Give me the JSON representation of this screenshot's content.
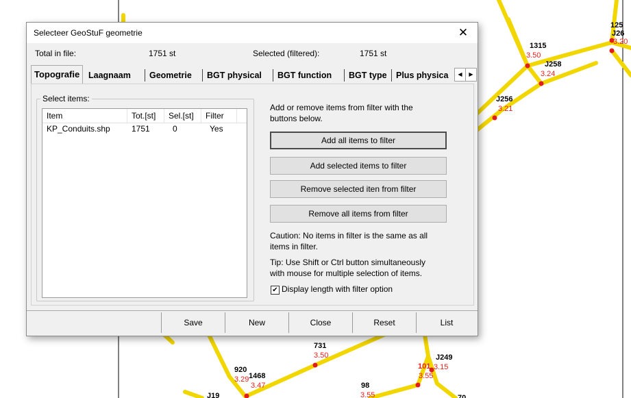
{
  "dialog": {
    "title": "Selecteer GeoStuF geometrie",
    "total_label": "Total in file:",
    "total_value": "1751 st",
    "selected_label": "Selected (filtered):",
    "selected_value": "1751 st"
  },
  "tabs": [
    "Topografie",
    "Laagnaam",
    "Geometrie",
    "BGT physical",
    "BGT function",
    "BGT type",
    "Plus physica"
  ],
  "group": {
    "title": "Select items:",
    "columns": [
      "Item",
      "Tot.[st]",
      "Sel.[st]",
      "Filter"
    ],
    "rows": [
      {
        "item": "KP_Conduits.shp",
        "tot": "1751",
        "sel": "0",
        "filter": "Yes"
      }
    ]
  },
  "help": {
    "line1": "Add or remove items from filter with the",
    "line2": "buttons below.",
    "caution1": "Caution: No items in filter is the same as all",
    "caution2": "items in filter.",
    "tip1": "Tip: Use Shift or Ctrl button simultaneously",
    "tip2": "with mouse for multiple selection of items."
  },
  "buttons": {
    "add_all": "Add all items to filter",
    "add_selected": "Add selected items to filter",
    "remove_selected": "Remove selected iten from filter",
    "remove_all": "Remove all items from filter"
  },
  "checkbox": {
    "label": "Display length with filter option",
    "checked": true
  },
  "bottom_buttons": [
    "Save",
    "New",
    "Close",
    "Reset",
    "List"
  ],
  "map_labels": {
    "n1315": "1315",
    "v1315": "3.50",
    "nJ258": "J258",
    "vJ258": "3.24",
    "nJ256": "J256",
    "vJ256": "3.21",
    "n125a": "125",
    "n125b": "J26",
    "v125": "3.20",
    "n731": "731",
    "v731": "3.50",
    "n920": "920",
    "v920": "3.29",
    "n1468": "1468",
    "v1468": "3.47",
    "n101": "101",
    "v101": "3.55",
    "nJ249": "J249",
    "vJ249": "3.15",
    "n98": "98",
    "v98": "3.55",
    "nJ19": "J19",
    "n70": "70"
  }
}
